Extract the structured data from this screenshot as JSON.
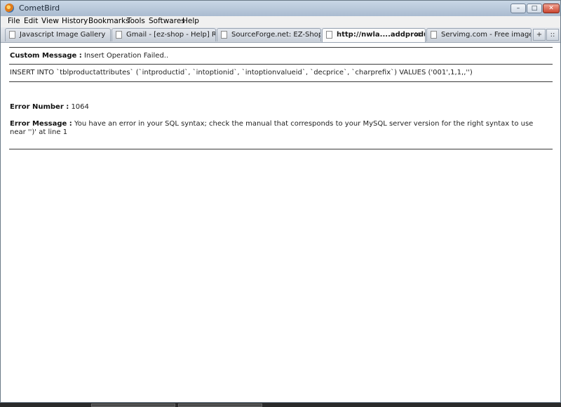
{
  "window": {
    "title": "CometBird"
  },
  "menu": [
    "File",
    "Edit",
    "View",
    "History",
    "Bookmarks",
    "Tools",
    "Softwares",
    "Help"
  ],
  "tabs": [
    {
      "label": "Javascript Image Gallery"
    },
    {
      "label": "Gmail - [ez-shop - Help] RE: ..."
    },
    {
      "label": "SourceForge.net: EZ-Shop (O..."
    },
    {
      "label": "http://nwla....addproduct"
    },
    {
      "label": "Servimg.com - Free image h..."
    }
  ],
  "tab_buttons": {
    "new_tab": "+",
    "list_tabs": "::"
  },
  "page": {
    "custom_message_label": "Custom Message :",
    "custom_message_value": "Insert Operation Failed..",
    "sql": "INSERT INTO `tblproductattributes` (`intproductid`, `intoptionid`, `intoptionvalueid`, `decprice`, `charprefix`) VALUES ('001',1,1,,'')",
    "error_number_label": "Error Number :",
    "error_number_value": "1064",
    "error_message_label": "Error Message :",
    "error_message_value": "You have an error in your SQL syntax; check the manual that corresponds to your MySQL server version for the right syntax to use near '')' at line 1"
  }
}
